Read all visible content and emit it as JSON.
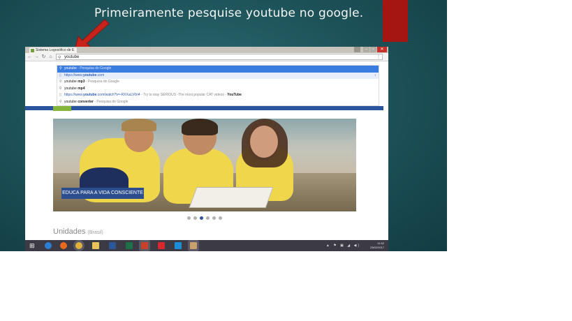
{
  "slide": {
    "caption": "Primeiramente pesquise youtube no google.",
    "accent_color": "#a51612",
    "arrow_color": "#c7231b"
  },
  "browser": {
    "tab_title": "Sistema Logosófico de E",
    "omnibox_value": "youtube",
    "suggestions": [
      {
        "icon": "search-icon",
        "bold": "youtube",
        "text": "",
        "muted": " - Pesquisa do Google"
      },
      {
        "icon": "page-icon",
        "prefix": "https://www.",
        "bold": "youtube",
        "text": ".com",
        "muted": ""
      },
      {
        "icon": "search-icon",
        "prefix": "youtube ",
        "bold": "mp3",
        "text": "",
        "muted": " - Pesquisa do Google"
      },
      {
        "icon": "search-icon",
        "prefix": "youtube ",
        "bold": "mp4",
        "text": "",
        "muted": ""
      },
      {
        "icon": "page-icon",
        "prefix": "https://www.",
        "bold": "youtube",
        "text": ".com/watch?v=-RXXaLV0n4",
        "muted": " - Try to stay SERIOUS -The most popular CAT videos - ",
        "tail": "YouTube"
      },
      {
        "icon": "search-icon",
        "prefix": "youtube ",
        "bold": "converter",
        "text": "",
        "muted": " - Pesquisa do Google"
      }
    ],
    "site_color": "#2c55a0",
    "site_accent": "#86b53c"
  },
  "site": {
    "banner_text": "EDUCA PARA A VIDA CONSCIENTE",
    "section_title": "Unidades",
    "section_sub": "(Brasil)",
    "carousel_active_index": 2,
    "carousel_count": 6
  },
  "taskbar": {
    "time": "11:52",
    "date": "23/02/2017",
    "tray_icons": "▲ ⚑ ▣ ◢ ◀)"
  }
}
